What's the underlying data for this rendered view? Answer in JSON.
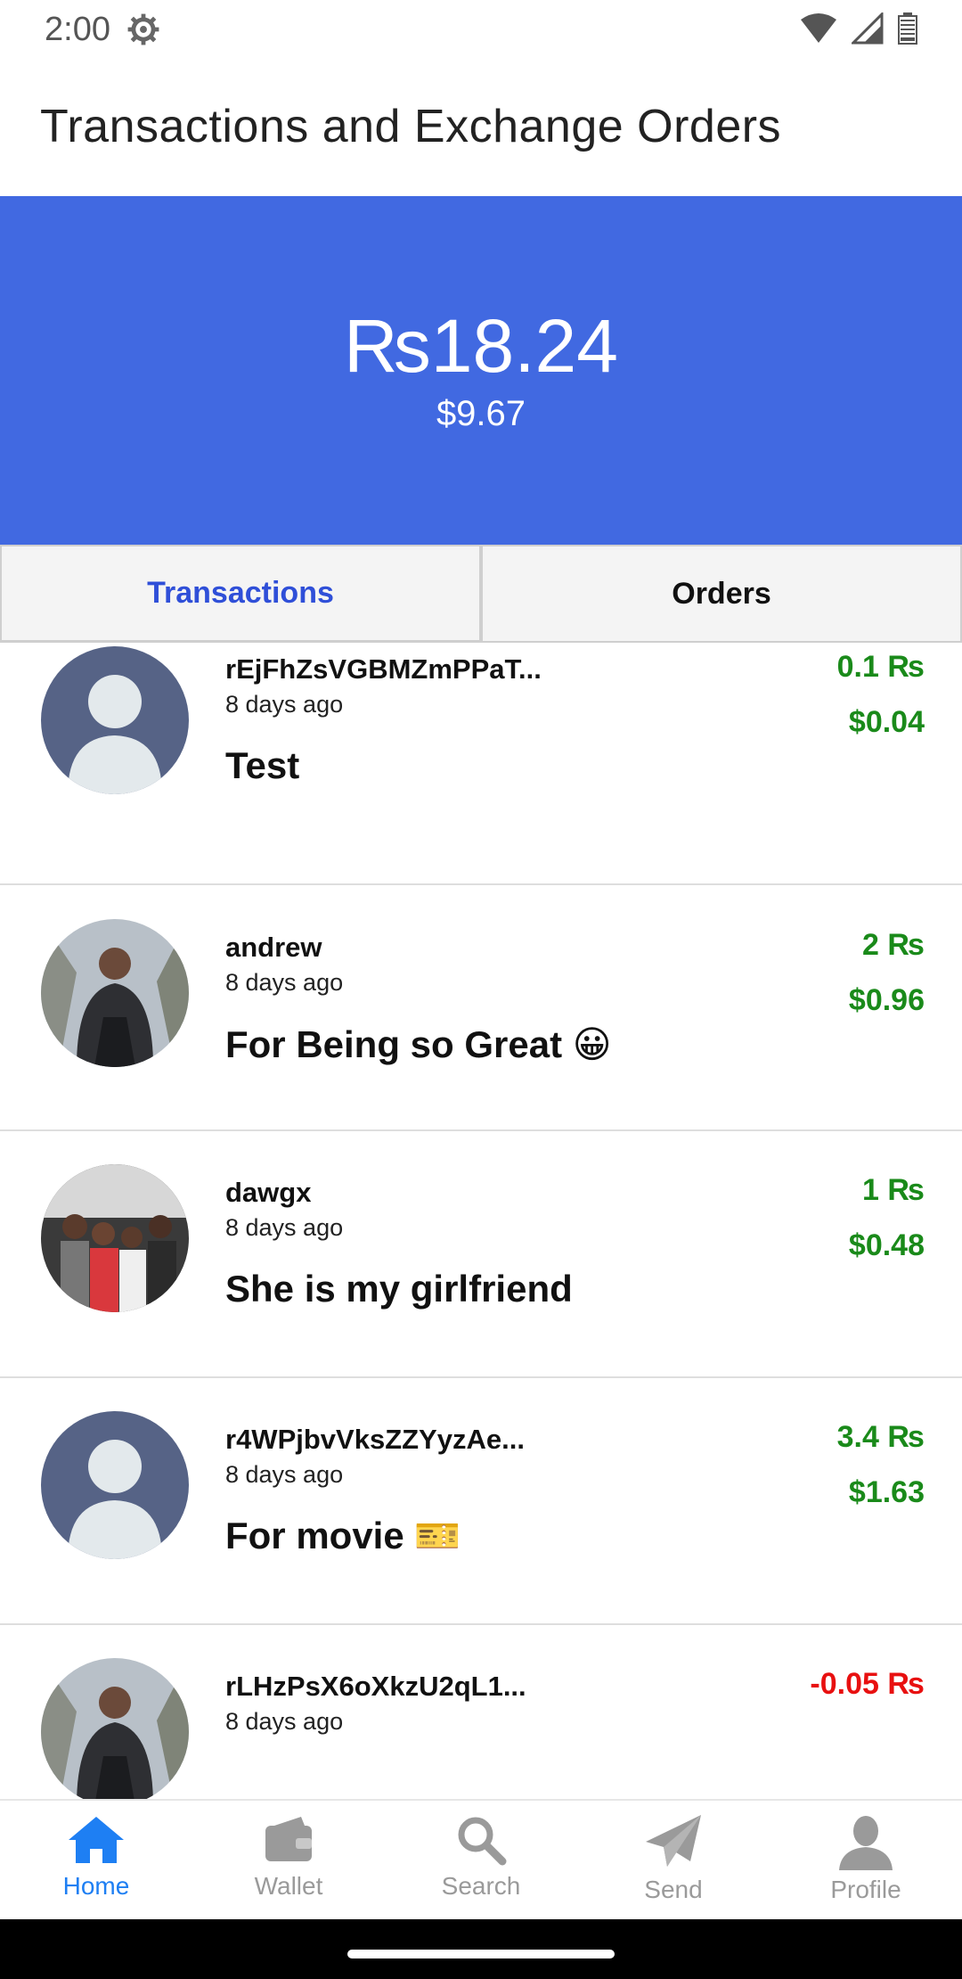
{
  "status": {
    "time": "2:00"
  },
  "header": {
    "title": "Transactions and Exchange Orders"
  },
  "balance": {
    "main": "₨18.24",
    "usd": "$9.67"
  },
  "tabs": [
    {
      "label": "Transactions",
      "active": true
    },
    {
      "label": "Orders",
      "active": false
    }
  ],
  "transactions": [
    {
      "name": "rEjFhZsVGBMZmPPaT...",
      "time": "8 days ago",
      "memo": "Test",
      "amount": "0.1 ₨",
      "usd": "$0.04",
      "direction": "in",
      "avatar": "default-avatar"
    },
    {
      "name": "andrew",
      "time": "8 days ago",
      "memo": "For Being so Great 😀",
      "amount": "2 ₨",
      "usd": "$0.96",
      "direction": "in",
      "avatar": "photo-person"
    },
    {
      "name": "dawgx",
      "time": "8 days ago",
      "memo": "She is my girlfriend",
      "amount": "1 ₨",
      "usd": "$0.48",
      "direction": "in",
      "avatar": "photo-group"
    },
    {
      "name": "r4WPjbvVksZZYyzAe...",
      "time": "8 days ago",
      "memo": "For movie 🎫",
      "amount": "3.4 ₨",
      "usd": "$1.63",
      "direction": "in",
      "avatar": "default-avatar"
    },
    {
      "name": "rLHzPsX6oXkzU2qL1...",
      "time": "8 days ago",
      "memo": "",
      "amount": "-0.05 ₨",
      "usd": "",
      "direction": "out",
      "avatar": "photo-person"
    }
  ],
  "nav": [
    {
      "label": "Home",
      "icon": "home-icon",
      "active": true
    },
    {
      "label": "Wallet",
      "icon": "wallet-icon",
      "active": false
    },
    {
      "label": "Search",
      "icon": "search-icon",
      "active": false
    },
    {
      "label": "Send",
      "icon": "send-icon",
      "active": false
    },
    {
      "label": "Profile",
      "icon": "profile-icon",
      "active": false
    }
  ],
  "colors": {
    "accent": "#4169e1",
    "positive": "#1a8a1a",
    "negative": "#e81010",
    "nav_active": "#1e7ff3"
  }
}
